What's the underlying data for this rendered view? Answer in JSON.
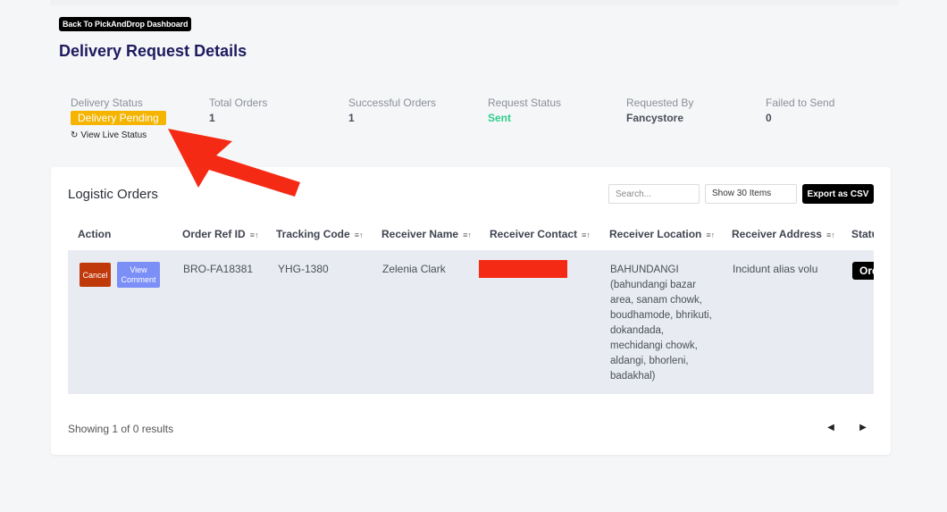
{
  "header": {
    "back_label": "Back To PickAndDrop Dashboard",
    "title": "Delivery Request Details"
  },
  "stats": {
    "delivery_status": {
      "label": "Delivery Status",
      "value": "Delivery Pending",
      "color": "#f4b400"
    },
    "view_live_status": "View Live Status",
    "total_orders": {
      "label": "Total Orders",
      "value": "1"
    },
    "successful_orders": {
      "label": "Successful Orders",
      "value": "1"
    },
    "request_status": {
      "label": "Request Status",
      "value": "Sent",
      "color": "#2fcf8a"
    },
    "requested_by": {
      "label": "Requested By",
      "value": "Fancystore"
    },
    "failed_to_send": {
      "label": "Failed to Send",
      "value": "0"
    }
  },
  "orders_card": {
    "title": "Logistic Orders",
    "search_placeholder": "Search...",
    "show_items": "Show 30 Items",
    "export_label": "Export as CSV",
    "columns": [
      "Action",
      "Order Ref ID",
      "Tracking Code",
      "Receiver Name",
      "Receiver Contact",
      "Receiver Location",
      "Receiver Address",
      "Status"
    ],
    "rows": [
      {
        "cancel_label": "Cancel",
        "view_comment_label": "View Comment",
        "order_ref_id": "BRO-FA18381",
        "tracking_code": "YHG-1380",
        "receiver_name": "Zelenia Clark",
        "receiver_location": "BAHUNDANGI (bahundangi bazar area, sanam chowk, boudhamode, bhrikuti, dokandada, mechidangi chowk, aldangi, bhorleni, badakhal)",
        "receiver_address": "Incidunt alias volu",
        "status": "Order"
      }
    ],
    "showing_text": "Showing 1 of 0 results"
  },
  "colors": {
    "title": "#1e1a5e",
    "cancel": "#c0390b",
    "view_comment": "#7b8ff7",
    "redaction": "#f52a14",
    "arrow": "#f52a14"
  }
}
